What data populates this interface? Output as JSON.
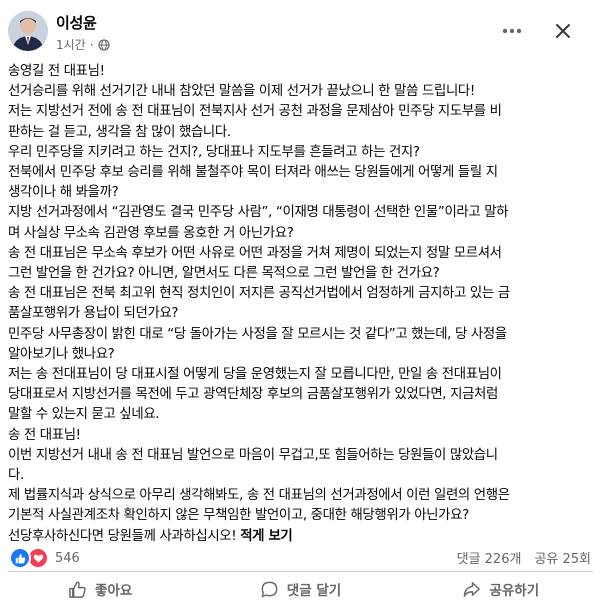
{
  "post": {
    "author": "이성윤",
    "time": "1시간",
    "separator": "·",
    "privacy_icon": "globe-icon",
    "menu_icon": "more-icon",
    "close_icon": "close-icon"
  },
  "body_lines": [
    "송영길 전 대표님!",
    "선거승리를 위해 선거기간 내내 참았던 말씀을 이제 선거가 끝났으니 한 말씀 드립니다!",
    "저는 지방선거 전에 송 전 대표님이 전북지사 선거 공천 과정을 문제삼아 민주당 지도부를 비",
    "판하는 걸 듣고, 생각을 참 많이 했습니다.",
    "우리 민주당을 지키려고 하는 건지?, 당대표나 지도부를 흔들려고 하는 건지?",
    "전북에서 민주당 후보 승리를 위해 불철주야 목이 터져라 애쓰는 당원들에게 어떻게 들릴 지",
    "생각이나 해 봐을까?",
    "지방 선거과정에서 “김관영도 결국 민주당 사람”, “이재명 대통령이 선택한 인물”이라고 말하",
    "며 사실상 무소속 김관영 후보를 옹호한 거 아닌가요?",
    "송 전 대표님은 무소속 후보가 어떤 사유로 어떤 과정을 거쳐 제명이 되었는지 정말 모르셔서",
    "그런 발언을 한 건가요? 아니면, 알면서도 다른 목적으로 그런 발언을 한 건가요?",
    "송 전 대표님은 전북 최고위 현직 정치인이 저지른 공직선거법에서 엄정하게 금지하고 있는 금",
    "품살포행위가 용납이 되던가요?",
    "민주당 사무총장이 밝힌 대로 “당 돌아가는 사정을 잘 모르시는 것 같다”고 했는데,  당 사정을",
    "알아보기나 했나요?",
    "저는 송 전대표님이 당 대표시절 어떻게 당을 운영했는지 잘 모릅니다만, 만일 송 전대표님이",
    "당대표로서 지방선거를 목전에 두고 광역단체장 후보의 금품살포행위가 있었다면, 지금처럼",
    "말할 수 있는지 묻고 싶네요.",
    "송 전 대표님!",
    "이번 지방선거 내내 송 전 대표님 발언으로 마음이 무겁고,또  힘들어하는 당원들이 많았습니",
    "다.",
    "제 법률지식과 상식으로 아무리 생각해봐도, 송 전 대표님의 선거과정에서 이런 일련의 언행은",
    "기본적 사실관계조차 확인하지 않은 무책임한 발언이고, 중대한 해당행위가 아닌가요?"
  ],
  "last_line": "선당후사하신다면 당원들께 사과하십시오!",
  "see_more": "적게 보기",
  "stats": {
    "reaction_count": "546",
    "reaction_icons": [
      "like-icon",
      "love-icon"
    ],
    "comments": "댓글 226개",
    "shares": "공유 25회"
  },
  "actions": {
    "like": "좋아요",
    "comment": "댓글 달기",
    "share": "공유하기"
  },
  "colors": {
    "text": "#050505",
    "secondary": "#65676b",
    "like_blue": "#1877f2",
    "love_red": "#f33e58",
    "divider": "#ced0d4"
  }
}
